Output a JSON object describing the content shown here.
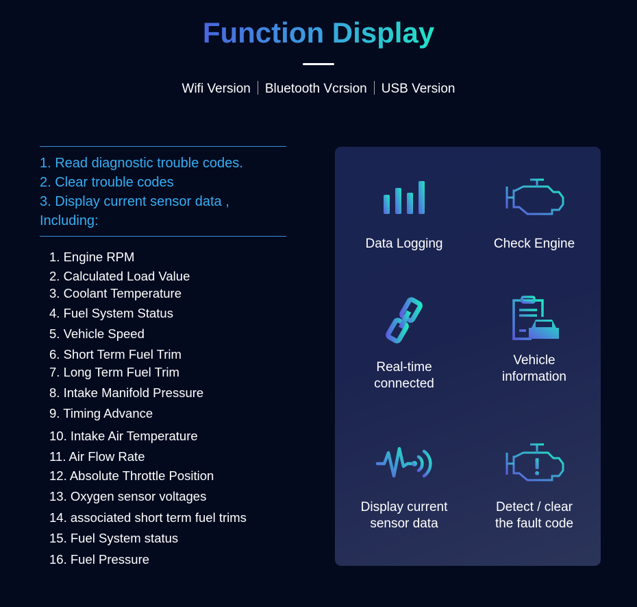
{
  "header": {
    "title": "Function Display",
    "versions": [
      "Wifi Version",
      "Bluetooth Vcrsion",
      "USB Version"
    ]
  },
  "features": [
    "1. Read diagnostic trouble codes.",
    "2. Clear trouble codes",
    "3. Display current sensor data ,",
    "Including:"
  ],
  "parameters": [
    "1. Engine RPM",
    "2. Calculated Load Value",
    "3. Coolant Temperature",
    "4. Fuel System Status",
    "5. Vehicle Speed",
    "6. Short Term Fuel Trim",
    "7. Long Term Fuel Trim",
    "8. Intake Manifold Pressure",
    "9. Timing Advance",
    "10. Intake Air Temperature",
    "11. Air Flow Rate",
    "12. Absolute Throttle Position",
    "13. Oxygen sensor voltages",
    "14. associated short term fuel trims",
    "15. Fuel System status",
    "16. Fuel Pressure"
  ],
  "panel": {
    "items": [
      {
        "icon": "bar-chart-icon",
        "label1": "Data Logging",
        "label2": ""
      },
      {
        "icon": "engine-icon",
        "label1": "Check Engine",
        "label2": ""
      },
      {
        "icon": "link-icon",
        "label1": "Real-time",
        "label2": "connected"
      },
      {
        "icon": "clipboard-car-icon",
        "label1": "Vehicle",
        "label2": "information"
      },
      {
        "icon": "signal-wave-icon",
        "label1": "Display current",
        "label2": "sensor data"
      },
      {
        "icon": "engine-warning-icon",
        "label1": "Detect / clear",
        "label2": "the fault code"
      }
    ]
  },
  "colors": {
    "background": "#040a1e",
    "accent_blue": "#36aef2",
    "gradient_start": "#4a66dc",
    "gradient_end": "#22e3c6"
  }
}
